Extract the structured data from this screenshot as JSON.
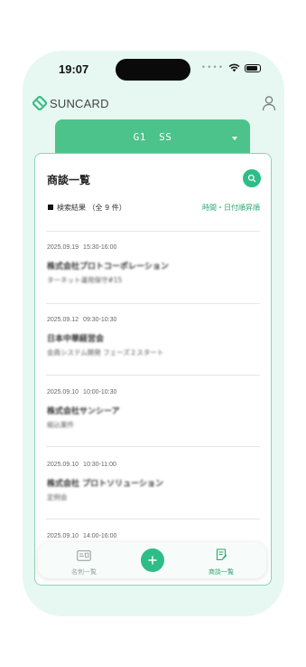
{
  "status_bar": {
    "time": "19:07",
    "signal_icon": "cellular-dots",
    "wifi_icon": "wifi-icon",
    "battery_icon": "battery-icon"
  },
  "header": {
    "logo_text": "SUNCARD",
    "logo_icon": "suncard-logo-icon",
    "user_icon": "user-icon"
  },
  "selector": {
    "label": "G1  SS",
    "caret_icon": "chevron-down-icon"
  },
  "panel": {
    "title": "商談一覧",
    "search_icon": "search-icon",
    "result_label": "検索結果 （全 9 件）",
    "sort_label": "時間・日付順昇順"
  },
  "meetings": [
    {
      "date": "2025.09.19",
      "time": "15:30-16:00",
      "company": "株式会社プロトコーポレーション",
      "subject": "ターネット運用保守#15"
    },
    {
      "date": "2025.09.12",
      "time": "09:30-10:30",
      "company": "日本中華経営会",
      "subject": "会員システム開発 フェーズ２スタート"
    },
    {
      "date": "2025.09.10",
      "time": "10:00-10:30",
      "company": "株式会社サンシーア",
      "subject": "組込案件"
    },
    {
      "date": "2025.09.10",
      "time": "10:30-11:00",
      "company": "株式会社 プロトソリューション",
      "subject": "定例会"
    },
    {
      "date": "2025.09.10",
      "time": "14:00-16:00",
      "company": "",
      "subject": ""
    }
  ],
  "bottom_nav": {
    "left_label": "名刺一覧",
    "right_label": "商談一覧",
    "add_icon": "plus-icon"
  },
  "colors": {
    "accent": "#2ebd86",
    "selector": "#4cc38a",
    "background": "#e6f8f1",
    "active_text": "#2aa96f"
  }
}
